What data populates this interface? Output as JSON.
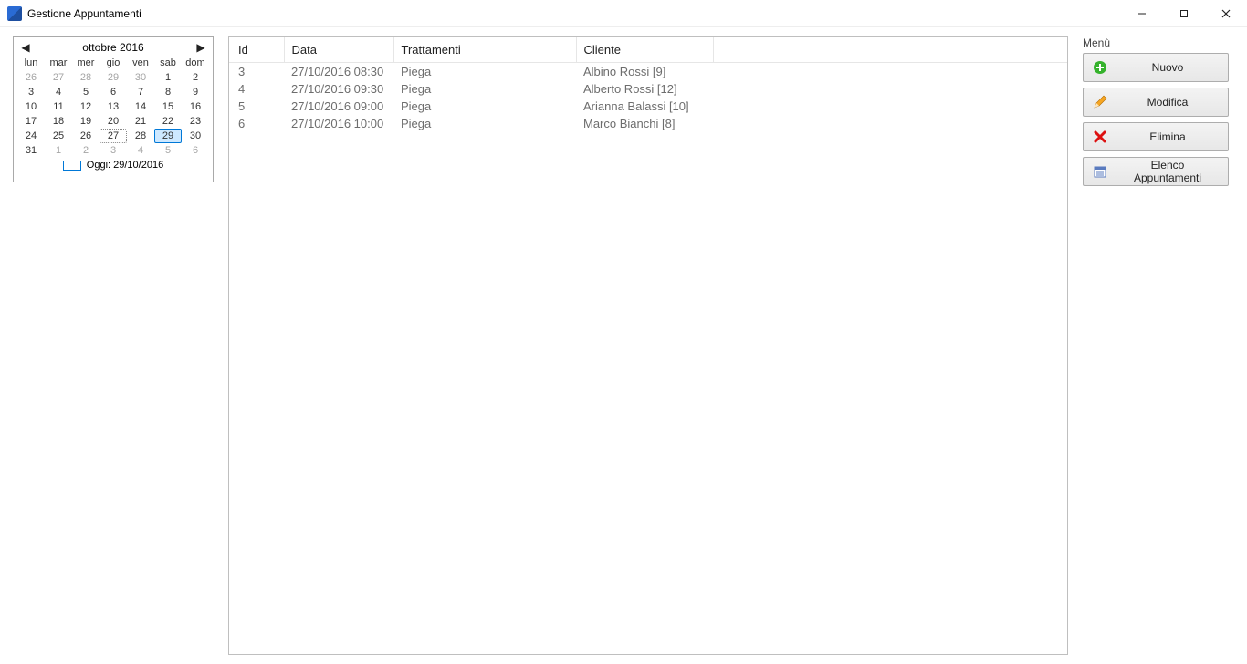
{
  "window": {
    "title": "Gestione Appuntamenti"
  },
  "calendar": {
    "month_label": "ottobre 2016",
    "dow": [
      "lun",
      "mar",
      "mer",
      "gio",
      "ven",
      "sab",
      "dom"
    ],
    "weeks": [
      [
        {
          "d": "26",
          "other": true
        },
        {
          "d": "27",
          "other": true
        },
        {
          "d": "28",
          "other": true
        },
        {
          "d": "29",
          "other": true
        },
        {
          "d": "30",
          "other": true
        },
        {
          "d": "1"
        },
        {
          "d": "2"
        }
      ],
      [
        {
          "d": "3"
        },
        {
          "d": "4"
        },
        {
          "d": "5"
        },
        {
          "d": "6"
        },
        {
          "d": "7"
        },
        {
          "d": "8"
        },
        {
          "d": "9"
        }
      ],
      [
        {
          "d": "10"
        },
        {
          "d": "11"
        },
        {
          "d": "12"
        },
        {
          "d": "13"
        },
        {
          "d": "14"
        },
        {
          "d": "15"
        },
        {
          "d": "16"
        }
      ],
      [
        {
          "d": "17"
        },
        {
          "d": "18"
        },
        {
          "d": "19"
        },
        {
          "d": "20"
        },
        {
          "d": "21"
        },
        {
          "d": "22"
        },
        {
          "d": "23"
        }
      ],
      [
        {
          "d": "24"
        },
        {
          "d": "25"
        },
        {
          "d": "26"
        },
        {
          "d": "27",
          "dot": true
        },
        {
          "d": "28"
        },
        {
          "d": "29",
          "sel": true
        },
        {
          "d": "30"
        }
      ],
      [
        {
          "d": "31"
        },
        {
          "d": "1",
          "other": true
        },
        {
          "d": "2",
          "other": true
        },
        {
          "d": "3",
          "other": true
        },
        {
          "d": "4",
          "other": true
        },
        {
          "d": "5",
          "other": true
        },
        {
          "d": "6",
          "other": true
        }
      ]
    ],
    "today_label": "Oggi: 29/10/2016"
  },
  "table": {
    "headers": {
      "id": "Id",
      "data": "Data",
      "trattamenti": "Trattamenti",
      "cliente": "Cliente"
    },
    "rows": [
      {
        "id": "3",
        "data": "27/10/2016 08:30",
        "trattamenti": "Piega",
        "cliente": "Albino Rossi [9]"
      },
      {
        "id": "4",
        "data": "27/10/2016 09:30",
        "trattamenti": "Piega",
        "cliente": "Alberto Rossi [12]"
      },
      {
        "id": "5",
        "data": "27/10/2016 09:00",
        "trattamenti": "Piega",
        "cliente": "Arianna Balassi [10]"
      },
      {
        "id": "6",
        "data": "27/10/2016 10:00",
        "trattamenti": "Piega",
        "cliente": "Marco Bianchi [8]"
      }
    ]
  },
  "menu": {
    "label": "Menù",
    "buttons": {
      "nuovo": "Nuovo",
      "modifica": "Modifica",
      "elimina": "Elimina",
      "elenco": "Elenco Appuntamenti"
    }
  }
}
